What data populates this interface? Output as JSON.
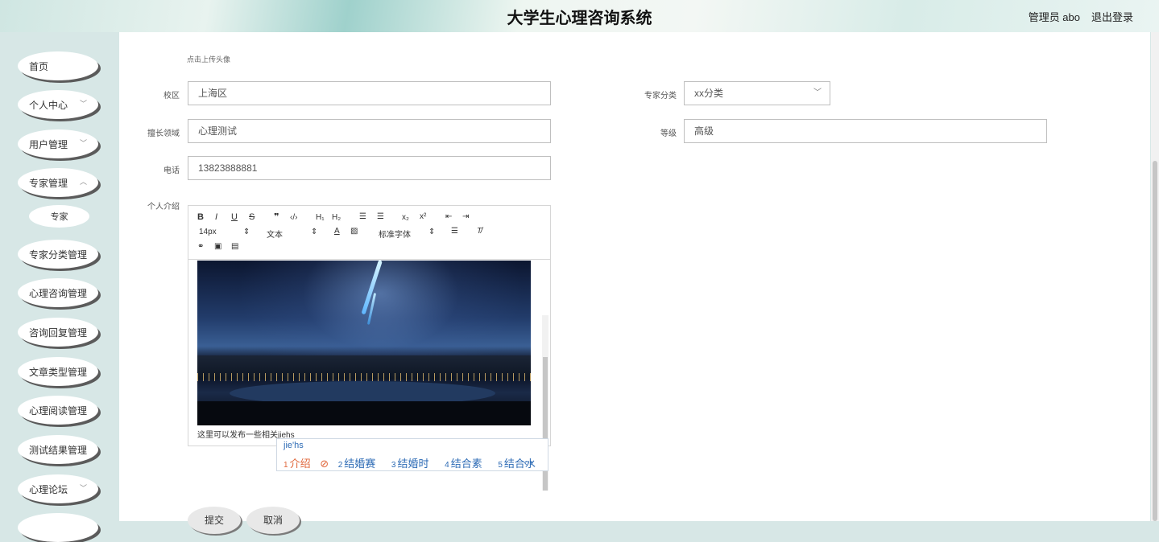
{
  "header": {
    "title": "大学生心理咨询系统",
    "user": "管理员 abo",
    "logout": "退出登录"
  },
  "sidebar": {
    "items": [
      {
        "label": "首页"
      },
      {
        "label": "个人中心"
      },
      {
        "label": "用户管理"
      },
      {
        "label": "专家管理"
      },
      {
        "label": "专家"
      },
      {
        "label": "专家分类管理"
      },
      {
        "label": "心理咨询管理"
      },
      {
        "label": "咨询回复管理"
      },
      {
        "label": "文章类型管理"
      },
      {
        "label": "心理阅读管理"
      },
      {
        "label": "测试结果管理"
      },
      {
        "label": "心理论坛"
      }
    ]
  },
  "form": {
    "upload_hint": "点击上传头像",
    "campus_label": "校区",
    "campus_value": "上海区",
    "category_label": "专家分类",
    "category_value": "xx分类",
    "specialty_label": "擅长领域",
    "specialty_value": "心理测试",
    "level_label": "等级",
    "level_value": "高级",
    "phone_label": "电话",
    "phone_value": "13823888881",
    "intro_label": "个人介绍"
  },
  "editor": {
    "font_size": "14px",
    "header_select": "文本",
    "font_select": "标准字体",
    "content_text": "这里可以发布一些相关jiehs"
  },
  "ime": {
    "composition": "jie'hs",
    "candidates": [
      "介绍",
      "结婚赛",
      "结婚时",
      "结合素",
      "结合水"
    ]
  },
  "buttons": {
    "submit": "提交",
    "cancel": "取消"
  }
}
